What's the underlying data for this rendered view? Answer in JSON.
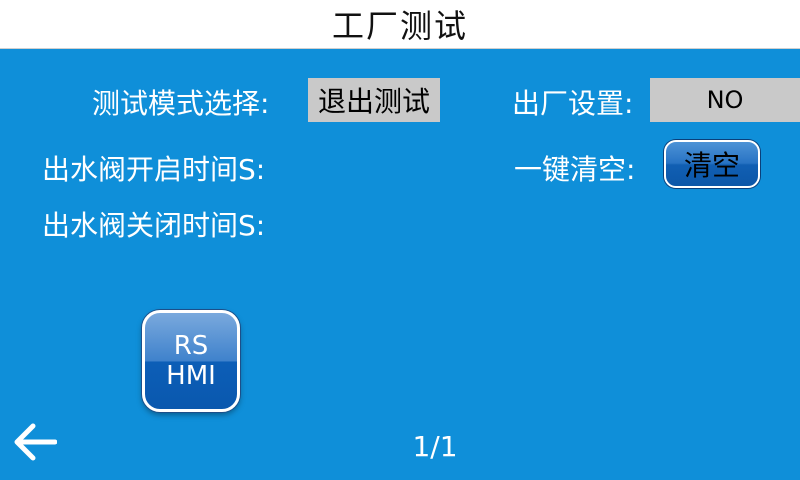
{
  "title": "工厂测试",
  "test_mode": {
    "label": "测试模式选择:",
    "value": "退出测试"
  },
  "factory_setting": {
    "label": "出厂设置:",
    "value": "NO"
  },
  "valve_open_time": {
    "label": "出水阀开启时间S:"
  },
  "valve_close_time": {
    "label": "出水阀关闭时间S:"
  },
  "one_key_clear": {
    "label": "一键清空:",
    "button_label": "清空"
  },
  "hmi_button": {
    "line1": "RS",
    "line2": "HMI"
  },
  "back_icon": "left-arrow-icon",
  "pager": "1/1",
  "colors": {
    "background": "#0f8fd9",
    "field": "#c9c9c9",
    "titlebar": "#ffffff"
  }
}
